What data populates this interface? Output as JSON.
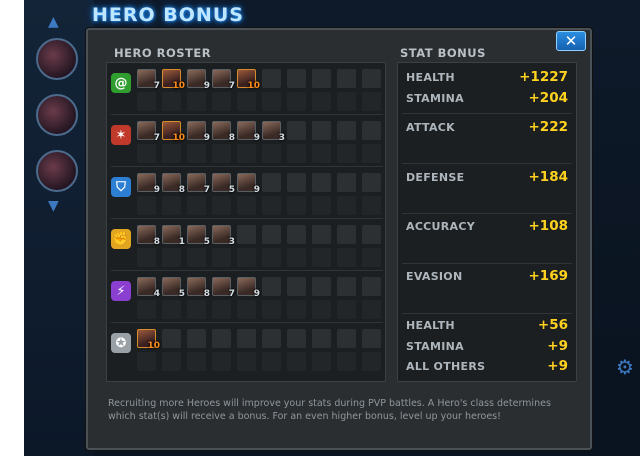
{
  "title": "HERO BONUS",
  "close_label": "✕",
  "roster_label": "HERO ROSTER",
  "stat_label": "STAT BONUS",
  "classes": [
    {
      "name": "cosmic",
      "icon": "spiral-icon",
      "color": "#2f9e2f",
      "glyph": "@",
      "heroes": [
        {
          "rank": "7"
        },
        {
          "rank": "10",
          "elite": true
        },
        {
          "rank": "9"
        },
        {
          "rank": "7"
        },
        {
          "rank": "10",
          "elite": true
        }
      ]
    },
    {
      "name": "blaster",
      "icon": "blast-icon",
      "color": "#c0392b",
      "glyph": "✶",
      "heroes": [
        {
          "rank": "7"
        },
        {
          "rank": "10",
          "elite": true
        },
        {
          "rank": "9"
        },
        {
          "rank": "8"
        },
        {
          "rank": "9"
        },
        {
          "rank": "3"
        }
      ]
    },
    {
      "name": "tactician",
      "icon": "shield-icon",
      "color": "#2d7fd3",
      "glyph": "⛉",
      "heroes": [
        {
          "rank": "9"
        },
        {
          "rank": "8"
        },
        {
          "rank": "7"
        },
        {
          "rank": "5"
        },
        {
          "rank": "9"
        }
      ]
    },
    {
      "name": "bruiser",
      "icon": "fist-icon",
      "color": "#e1a520",
      "glyph": "✊",
      "heroes": [
        {
          "rank": "8"
        },
        {
          "rank": "1"
        },
        {
          "rank": "5"
        },
        {
          "rank": "3"
        }
      ]
    },
    {
      "name": "infiltrator",
      "icon": "claw-icon",
      "color": "#8a3fd1",
      "glyph": "⚡",
      "heroes": [
        {
          "rank": "4"
        },
        {
          "rank": "5"
        },
        {
          "rank": "8"
        },
        {
          "rank": "7"
        },
        {
          "rank": "9"
        }
      ]
    },
    {
      "name": "generalist",
      "icon": "star-icon",
      "color": "#9aa1a6",
      "glyph": "✪",
      "heroes": [
        {
          "rank": "10",
          "elite": true
        }
      ]
    }
  ],
  "stats": [
    {
      "name": "HEALTH",
      "value": "+1227"
    },
    {
      "name": "STAMINA",
      "value": "+204"
    },
    {
      "name": "ATTACK",
      "value": "+222"
    },
    {
      "name": "DEFENSE",
      "value": "+184"
    },
    {
      "name": "ACCURACY",
      "value": "+108"
    },
    {
      "name": "EVASION",
      "value": "+169"
    },
    {
      "name": "HEALTH",
      "value": "+56"
    },
    {
      "name": "STAMINA",
      "value": "+9"
    },
    {
      "name": "ALL OTHERS",
      "value": "+9"
    }
  ],
  "footer": "Recruiting more Heroes will improve your stats during PVP battles. A Hero's class determines which stat(s) will receive a bonus. For an even higher bonus, level up your heroes!"
}
